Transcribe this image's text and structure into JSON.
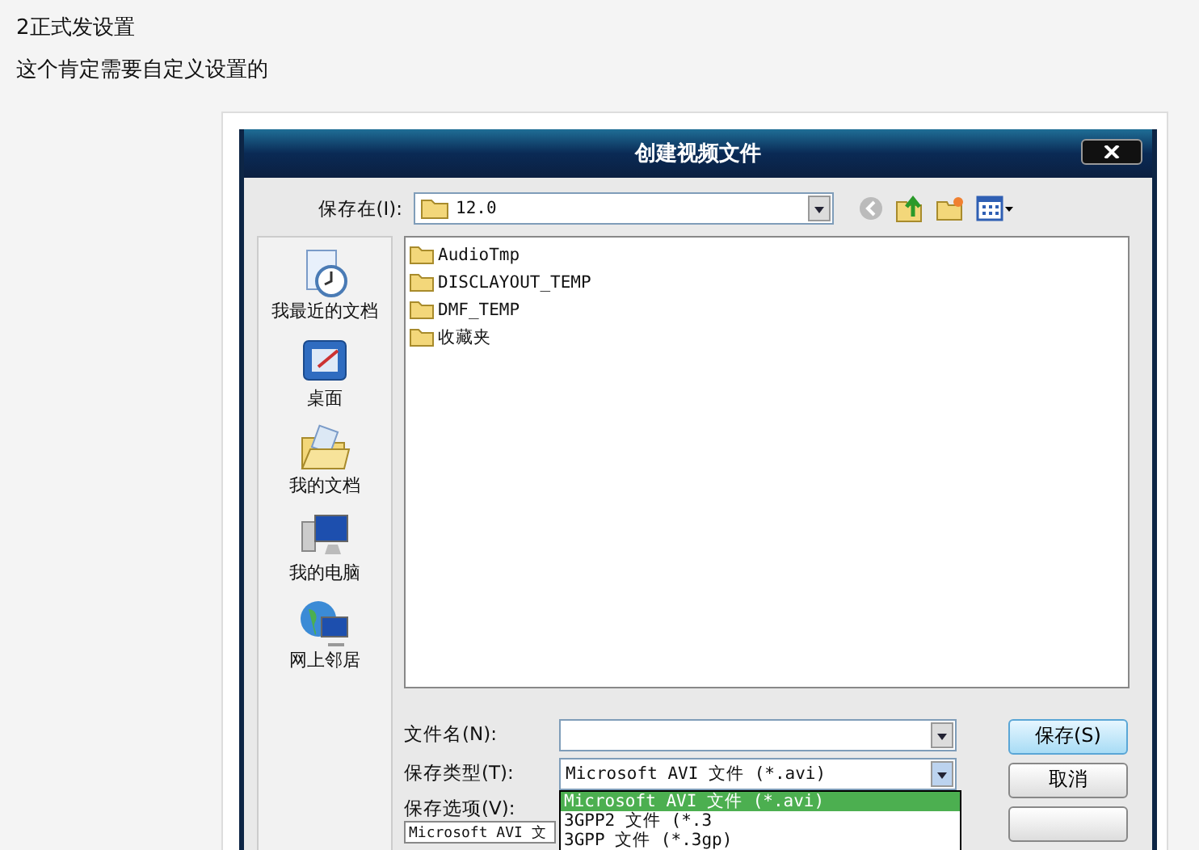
{
  "heading": "2正式发设置",
  "subtitle": "这个肯定需要自定义设置的",
  "dialog": {
    "title": "创建视频文件",
    "save_in": {
      "label": "保存在(I):",
      "value": "12.0"
    },
    "places": [
      {
        "kind": "recent",
        "label": "我最近的文档"
      },
      {
        "kind": "desktop",
        "label": "桌面"
      },
      {
        "kind": "documents",
        "label": "我的文档"
      },
      {
        "kind": "computer",
        "label": "我的电脑"
      },
      {
        "kind": "network",
        "label": "网上邻居"
      }
    ],
    "files": [
      {
        "name": "AudioTmp"
      },
      {
        "name": "DISCLAYOUT_TEMP"
      },
      {
        "name": "DMF_TEMP"
      },
      {
        "name": "收藏夹"
      }
    ],
    "file_name": {
      "label": "文件名(N):"
    },
    "file_type": {
      "label": "保存类型(T):",
      "value": "Microsoft AVI 文件 (*.avi)"
    },
    "type_options": [
      {
        "label": "Microsoft AVI 文件 (*.avi)",
        "selected": true
      },
      {
        "label": "3GPP2 文件 (*.3",
        "selected": false
      },
      {
        "label": "3GPP 文件 (*.3gp)",
        "selected": false
      }
    ],
    "save_options": {
      "label": "保存选项(V):",
      "value": "Microsoft AVI 文"
    },
    "buttons": [
      {
        "label": "保存(S)",
        "focused": true
      },
      {
        "label": "取消",
        "focused": false
      }
    ]
  }
}
